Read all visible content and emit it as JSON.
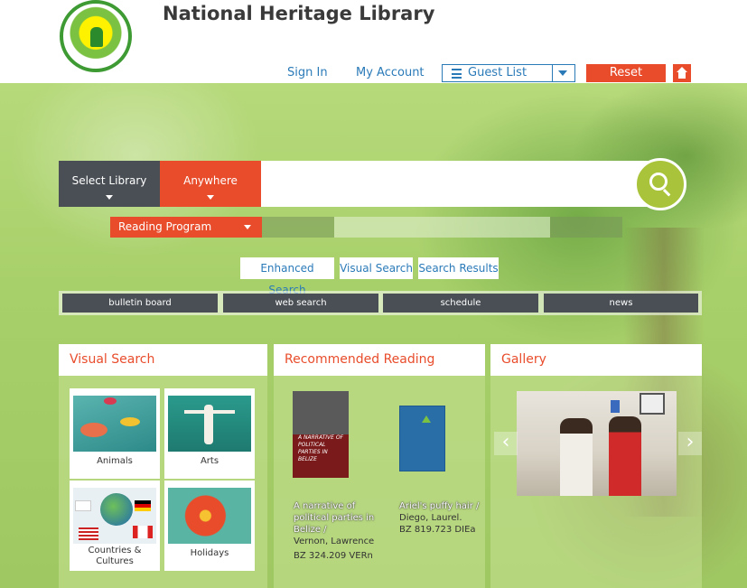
{
  "header": {
    "title": "National Heritage Library",
    "sign_in": "Sign In",
    "my_account": "My Account",
    "guest_list": "Guest List",
    "reset": "Reset"
  },
  "search": {
    "select_library": "Select Library",
    "anywhere": "Anywhere",
    "query": "",
    "reading_program": "Reading Program"
  },
  "tabs": [
    "Enhanced Search",
    "Visual Search",
    "Search Results"
  ],
  "quick_links": [
    "bulletin board",
    "web search",
    "schedule",
    "news"
  ],
  "visual_search": {
    "heading": "Visual Search",
    "tiles": [
      "Animals",
      "Arts",
      "Countries & Cultures",
      "Holidays"
    ]
  },
  "recommended": {
    "heading": "Recommended Reading",
    "books": [
      {
        "cover_text": "A NARRATIVE OF POLITICAL PARTIES IN BELIZE",
        "title": "A narrative of political parties in Belize /",
        "author": "Vernon, Lawrence",
        "call_number": "BZ 324.209 VERn"
      },
      {
        "cover_text": "",
        "title": "Ariel's puffy hair /",
        "author": "Diego, Laurel.",
        "call_number": "BZ 819.723 DIEa"
      }
    ]
  },
  "gallery": {
    "heading": "Gallery",
    "prev": "‹",
    "next": "›"
  },
  "colors": {
    "accent": "#e84c2b",
    "link": "#2a7ab8",
    "dark": "#4a4f55",
    "search_button": "#a9c43a"
  }
}
